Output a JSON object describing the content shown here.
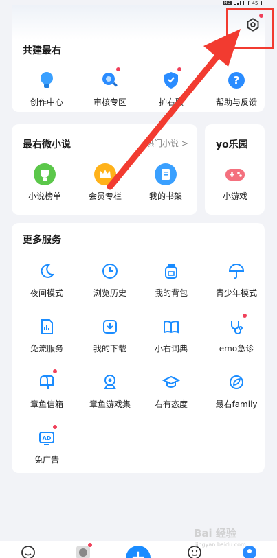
{
  "status": {
    "hd": "HD",
    "battery": "45"
  },
  "header": {
    "settings_icon": "gear-icon"
  },
  "colors": {
    "accent_blue": "#1a8cff",
    "badge_red": "#f0405a",
    "annotation_red": "#f23b30"
  },
  "top_section": {
    "title": "共建最右",
    "items": [
      {
        "label": "创作中心",
        "icon": "lightbulb-icon",
        "badge": false
      },
      {
        "label": "审核专区",
        "icon": "magnifier-icon",
        "badge": true
      },
      {
        "label": "护右联",
        "icon": "shield-icon",
        "badge": true
      },
      {
        "label": "帮助与反馈",
        "icon": "question-icon",
        "badge": false
      }
    ]
  },
  "novel_section": {
    "title": "最右微小说",
    "more": "热门小说 >",
    "items": [
      {
        "label": "小说榜单",
        "icon": "trophy-icon"
      },
      {
        "label": "会员专栏",
        "icon": "crown-icon"
      },
      {
        "label": "我的书架",
        "icon": "book-icon"
      }
    ]
  },
  "yo_section": {
    "title": "yo乐园",
    "items": [
      {
        "label": "小游戏",
        "icon": "gamepad-icon"
      }
    ]
  },
  "services": {
    "title": "更多服务",
    "items": [
      {
        "label": "夜间模式",
        "icon": "moon-icon",
        "badge": false
      },
      {
        "label": "浏览历史",
        "icon": "clock-icon",
        "badge": false
      },
      {
        "label": "我的背包",
        "icon": "backpack-icon",
        "badge": false
      },
      {
        "label": "青少年模式",
        "icon": "umbrella-icon",
        "badge": false
      },
      {
        "label": "免流服务",
        "icon": "sim-icon",
        "badge": false
      },
      {
        "label": "我的下载",
        "icon": "download-icon",
        "badge": false
      },
      {
        "label": "小右词典",
        "icon": "open-book-icon",
        "badge": false
      },
      {
        "label": "emo急诊",
        "icon": "stethoscope-icon",
        "badge": true
      },
      {
        "label": "章鱼信箱",
        "icon": "mailbox-icon",
        "badge": true
      },
      {
        "label": "章鱼游戏集",
        "icon": "webcam-icon",
        "badge": false
      },
      {
        "label": "右有态度",
        "icon": "graduation-cap-icon",
        "badge": false
      },
      {
        "label": "最右family",
        "icon": "leaf-badge-icon",
        "badge": false
      },
      {
        "label": "免广告",
        "icon": "ad-icon",
        "badge": true
      }
    ]
  },
  "bottom_nav": {
    "fab": "+",
    "items": [
      "smile-icon",
      "octopus-icon",
      "plus-icon",
      "face-icon",
      "profile-icon"
    ]
  },
  "watermark": {
    "main": "Bai 经验",
    "sub": "jingyan.baidu.com"
  }
}
